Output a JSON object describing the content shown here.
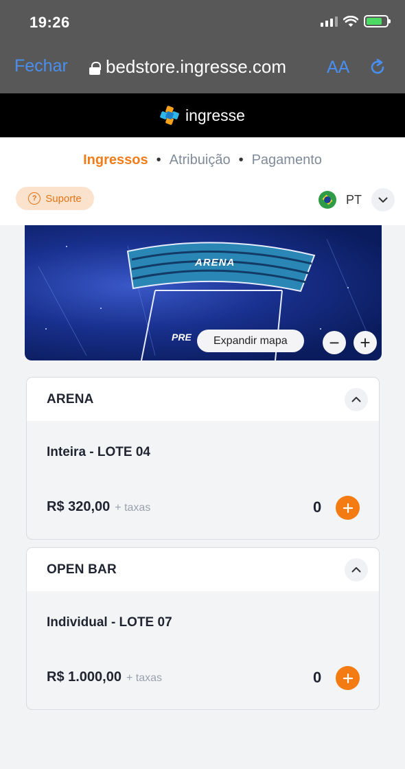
{
  "status_bar": {
    "time": "19:26"
  },
  "browser": {
    "done_label": "Fechar",
    "url": "bedstore.ingresse.com",
    "text_size_label": "AA"
  },
  "brand": {
    "name": "ingresse"
  },
  "steps": {
    "items": [
      "Ingressos",
      "Atribuição",
      "Pagamento"
    ],
    "active_index": 0,
    "separator": "•"
  },
  "support_label": "Suporte",
  "language": {
    "code": "PT"
  },
  "map": {
    "sector_label": "ARENA",
    "partial_label": "PRE",
    "expand_label": "Expandir mapa",
    "zoom_out_label": "−",
    "zoom_in_label": "+"
  },
  "sections": [
    {
      "title": "ARENA",
      "ticket": "Inteira - LOTE 04",
      "price": "R$ 320,00",
      "fees": "+ taxas",
      "quantity": "0"
    },
    {
      "title": "OPEN BAR",
      "ticket": "Individual - LOTE 07",
      "price": "R$ 1.000,00",
      "fees": "+ taxas",
      "quantity": "0"
    }
  ],
  "colors": {
    "accent": "#f07c1a",
    "browser_blue": "#4a8ff0",
    "header_bg": "#000000"
  }
}
